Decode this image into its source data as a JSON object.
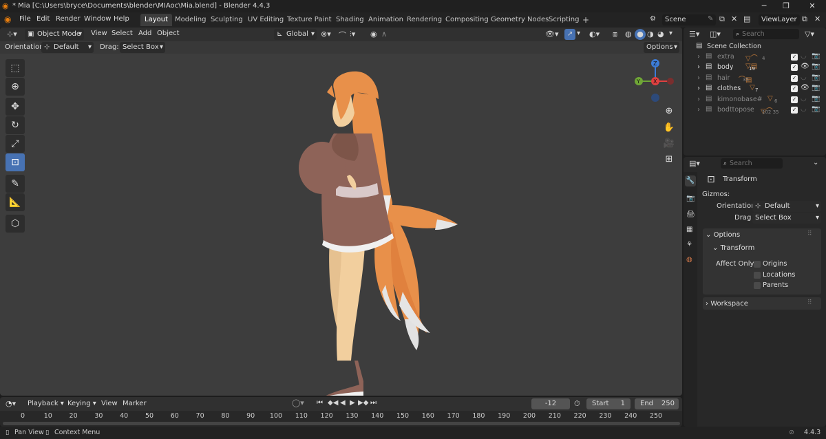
{
  "window": {
    "title": "* Mia [C:\\Users\\bryce\\Documents\\blender\\MIAoc\\Mia.blend] - Blender 4.4.3",
    "minimize": "─",
    "maximize": "❐",
    "close": "✕"
  },
  "menu": {
    "items": [
      "File",
      "Edit",
      "Render",
      "Window",
      "Help"
    ]
  },
  "workspaces": {
    "tabs": [
      "Layout",
      "Modeling",
      "Sculpting",
      "UV Editing",
      "Texture Paint",
      "Shading",
      "Animation",
      "Rendering",
      "Compositing",
      "Geometry Nodes",
      "Scripting"
    ],
    "add": "+",
    "active": "Layout"
  },
  "scene": {
    "name": "Scene",
    "view_layer": "ViewLayer"
  },
  "viewport_header": {
    "mode": "Object Mode",
    "menus": [
      "View",
      "Select",
      "Add",
      "Object"
    ],
    "transform_orientation": "Global"
  },
  "tool_settings": {
    "orientation_label": "Orientation:",
    "orientation_value": "Default",
    "drag_label": "Drag:",
    "drag_value": "Select Box",
    "options": "Options"
  },
  "gizmo": {
    "z": "Z",
    "y": "Y",
    "x": "X"
  },
  "outliner": {
    "search_placeholder": "Search",
    "root": "Scene Collection",
    "collections": [
      {
        "name": "extra",
        "badge": "4"
      },
      {
        "name": "body",
        "badge": "19"
      },
      {
        "name": "hair",
        "badge": "35"
      },
      {
        "name": "clothes",
        "badge": "7"
      },
      {
        "name": "kimonobase#",
        "badge": "6"
      },
      {
        "name": "bodttopose",
        "badge": "102 35"
      }
    ]
  },
  "properties": {
    "search_placeholder": "Search",
    "header": "Transform",
    "gizmos_label": "Gizmos:",
    "orientation_label": "Orientation",
    "orientation_value": "Default",
    "drag_label": "Drag",
    "drag_value": "Select Box",
    "options_panel": "Options",
    "transform_subpanel": "Transform",
    "affect_only_label": "Affect Only",
    "affect_origins": "Origins",
    "affect_locations": "Locations",
    "affect_parents": "Parents",
    "workspace_panel": "Workspace"
  },
  "timeline": {
    "menus": [
      "Playback",
      "Keying",
      "View",
      "Marker"
    ],
    "current_frame": "-12",
    "start_label": "Start",
    "start_value": "1",
    "end_label": "End",
    "end_value": "250",
    "ruler": [
      "0",
      "10",
      "20",
      "30",
      "40",
      "50",
      "60",
      "70",
      "80",
      "90",
      "100",
      "110",
      "120",
      "130",
      "140",
      "150",
      "160",
      "170",
      "180",
      "190",
      "200",
      "210",
      "220",
      "230",
      "240",
      "250"
    ]
  },
  "status": {
    "pan_view": "Pan View",
    "context_menu": "Context Menu",
    "version": "4.4.3"
  },
  "colors": {
    "accent": "#4772b3",
    "viewport_bg": "#3d3d3d",
    "hair": "#e8904a",
    "dress": "#8e6358",
    "skin": "#f2cf9e"
  }
}
